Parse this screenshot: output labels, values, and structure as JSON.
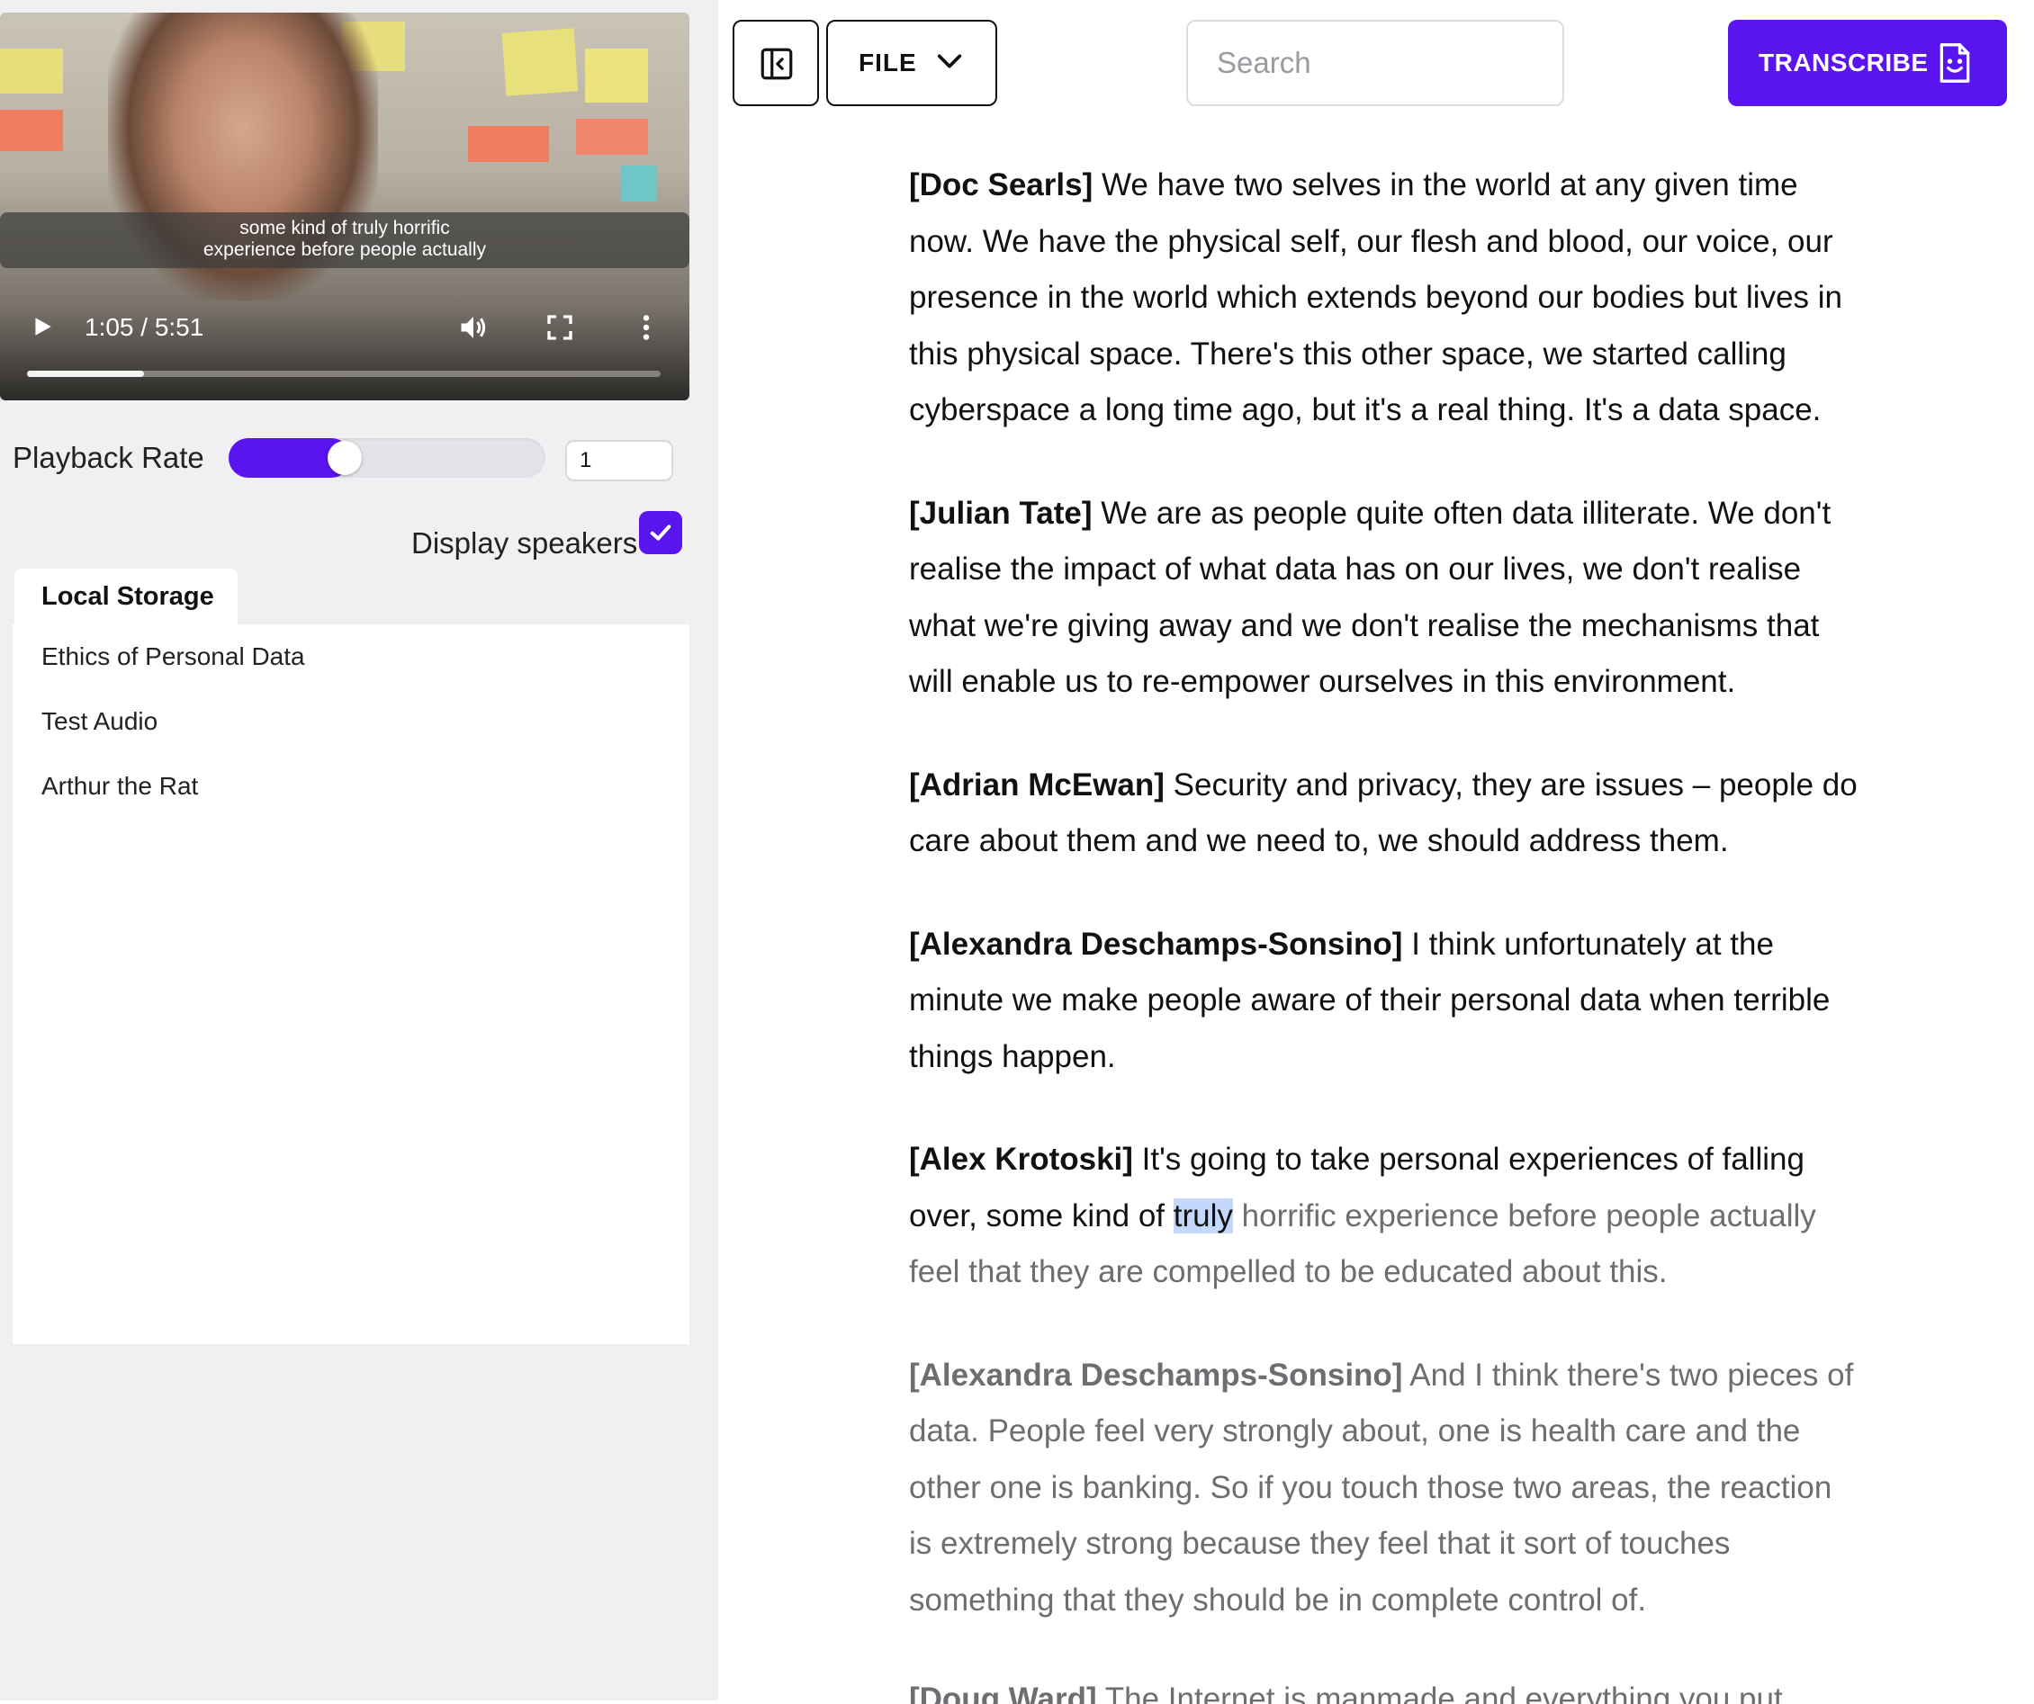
{
  "player": {
    "caption_line1": "some kind of truly horrific",
    "caption_line2": "experience before people actually",
    "time": "1:05 / 5:51",
    "progress": 0.185
  },
  "controls": {
    "playback_label": "Playback Rate",
    "playback_value": "1",
    "playback_fraction": 0.33,
    "speakers_label": "Display speakers",
    "speakers_checked": true
  },
  "storage": {
    "tab_label": "Local Storage",
    "items": [
      "Ethics of Personal Data",
      "Test Audio",
      "Arthur the Rat"
    ]
  },
  "toolbar": {
    "file_label": "FILE",
    "search_placeholder": "Search",
    "transcribe_label": "TRANSCRIBE"
  },
  "accent_color": "#5a14f0",
  "transcript": {
    "p1": {
      "speaker": "[Doc Searls]",
      "text": "We have two selves in the world at any given time now. We have the physical self, our flesh and blood, our voice, our presence in the world which extends beyond our bodies but lives in this physical space. There's this other space, we started calling cyberspace a long time ago, but it's a real thing. It's a data space."
    },
    "p2": {
      "speaker": "[Julian Tate]",
      "text": "We are as people quite often data illiterate. We don't realise the impact of what data has on our lives, we don't realise what we're giving away and we don't realise the mechanisms that will enable us to re-empower ourselves in this environment."
    },
    "p3": {
      "speaker": "[Adrian McEwan]",
      "text": "Security and privacy, they are issues – people do care about them and we need to, we should address them."
    },
    "p4": {
      "speaker": "[Alexandra Deschamps-Sonsino]",
      "text": "I think unfortunately at the minute we make people aware of their personal data when terrible things happen."
    },
    "p5": {
      "speaker": "[Alex Krotoski]",
      "text_before": "It's going to take personal experiences of falling over, some kind of",
      "current_word": "truly",
      "text_after": "horrific experience before people actually feel that they are compelled to be educated about this."
    },
    "p6": {
      "speaker": "[Alexandra Deschamps-Sonsino]",
      "text": "And I think there's two pieces of data. People feel very strongly about, one is health care and the other one is banking. So if you touch those two areas, the reaction is extremely strong because they feel that it sort of touches something that they should be in complete control of."
    },
    "p7": {
      "speaker": "[Doug Ward]",
      "text": "The Internet is manmade and everything you put"
    }
  }
}
